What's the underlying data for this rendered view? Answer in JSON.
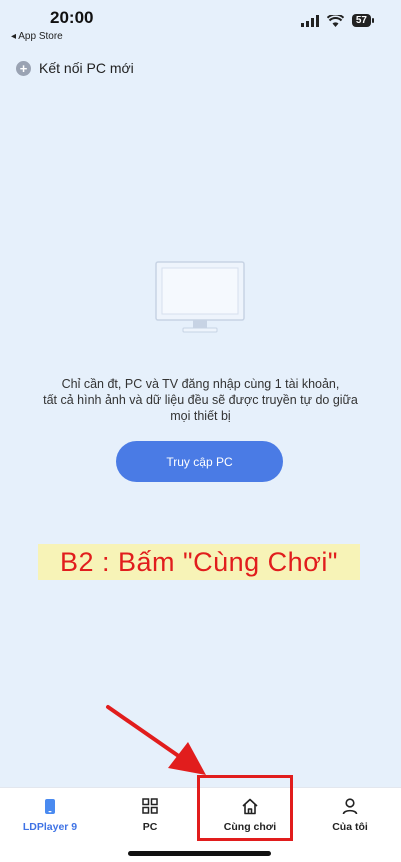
{
  "status_bar": {
    "time": "20:00",
    "back_label": "◂ App Store",
    "battery": "57"
  },
  "header": {
    "connect_label": "Kết nối PC mới"
  },
  "empty_state": {
    "message_line1": "Chỉ cần đt, PC và TV đăng nhập cùng 1 tài khoản,",
    "message_line2": "tất cả hình ảnh và dữ liệu đều sẽ được truyền tự do giữa",
    "message_line3": "mọi thiết bị"
  },
  "cta": {
    "label": "Truy cập PC"
  },
  "annotation": {
    "text": "B2 : Bấm \"Cùng Chơi\""
  },
  "tabs": [
    {
      "label": "LDPlayer 9",
      "icon": "phone-icon",
      "active": true
    },
    {
      "label": "PC",
      "icon": "grid-icon",
      "active": false
    },
    {
      "label": "Cùng chơi",
      "icon": "home-icon",
      "active": false
    },
    {
      "label": "Của tôi",
      "icon": "person-icon",
      "active": false
    }
  ],
  "colors": {
    "accent": "#4a7be5",
    "background": "#e6f0fb",
    "annotation_red": "#e11d1d",
    "annotation_bg": "#f7f3b7"
  }
}
